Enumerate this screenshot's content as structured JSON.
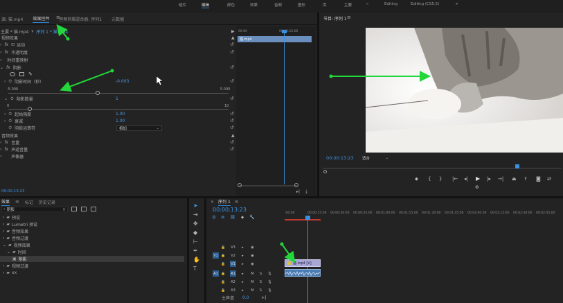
{
  "workspaces": [
    "组件",
    "编辑",
    "颜色",
    "效果",
    "音频",
    "图形",
    "库",
    "主要",
    "»",
    "Editing",
    "Editing (CS5.5)"
  ],
  "workspace_more": "»",
  "source_panel": {
    "tabs": [
      "源: 猫.mp4",
      "效果控件",
      "音频剪辑混合器: 序列1",
      "元数据"
    ],
    "breadcrumb_master": "主要 * 猫.mp4",
    "breadcrumb_seq": "序列 1 * 猫.mp4",
    "clip_label": "猫.mp4",
    "mini_ruler": [
      "00:00",
      "00:00:15:00"
    ],
    "video_effects": "视频效果",
    "motion": "运动",
    "opacity": "不透明度",
    "time_remap": "时间重映射",
    "shadow": "阴影",
    "shadow_time_label": "阴影时间（秒）",
    "shadow_time_value": "-0.003",
    "slider1_min": "-5.000",
    "slider1_max": "5.000",
    "shadow_count_label": "阴影数量",
    "shadow_count_value": "1",
    "slider2_min": "0",
    "slider2_max": "10",
    "start_intensity_label": "起始强度",
    "start_intensity_value": "1.00",
    "decay_label": "衰减",
    "decay_value": "1.00",
    "operator_label": "阴影运算符",
    "operator_value": "相加",
    "audio_effects": "音频效果",
    "volume": "音量",
    "channel_volume": "声道音量",
    "panner": "声像器",
    "timecode": "00:00:13:23"
  },
  "program_monitor": {
    "title": "节目: 序列 1",
    "timecode": "00:00:13:23",
    "fit_label": "适合",
    "fit_options": [
      "适合"
    ]
  },
  "effects_panel": {
    "tabs": [
      "效果",
      "标记",
      "历史记录"
    ],
    "search_value": "阴影",
    "tree": [
      {
        "label": "预设",
        "indent": 0
      },
      {
        "label": "Lumetri 预设",
        "indent": 0
      },
      {
        "label": "音频效果",
        "indent": 0
      },
      {
        "label": "音频过渡",
        "indent": 0
      },
      {
        "label": "视频效果",
        "indent": 0
      },
      {
        "label": "时间",
        "indent": 1
      },
      {
        "label": "阴影",
        "indent": 2
      },
      {
        "label": "视频过渡",
        "indent": 0
      },
      {
        "label": "xx",
        "indent": 0
      }
    ]
  },
  "timeline": {
    "tab": "序列 1",
    "timecode": "00:00:13:23",
    "ruler": [
      ":00:00",
      "00:00:15:00",
      "00:00:30:00",
      "00:00:45:00",
      "00:01:00:00",
      "00:01:15:00",
      "00:01:30:00",
      "00:01:45:00",
      "00:02:00:00",
      "00:02:15:00",
      "00:02:30:00",
      "00:02:45:00"
    ],
    "tracks": [
      {
        "name": "V3",
        "target": "",
        "kind": "video"
      },
      {
        "name": "V2",
        "target": "V1",
        "kind": "video"
      },
      {
        "name": "V1",
        "target": "",
        "kind": "video"
      },
      {
        "name": "A1",
        "target": "A1",
        "kind": "audio"
      },
      {
        "name": "A2",
        "target": "",
        "kind": "audio"
      },
      {
        "name": "A3",
        "target": "",
        "kind": "audio"
      }
    ],
    "master": "主声道",
    "master_value": "0.0",
    "clip_label": "猫.mp4 [V]",
    "track_btn_m": "M",
    "track_btn_s": "S"
  },
  "colors": {
    "accent": "#2f82d4",
    "arrow": "#23d63a",
    "timecode": "#3a93e6"
  }
}
